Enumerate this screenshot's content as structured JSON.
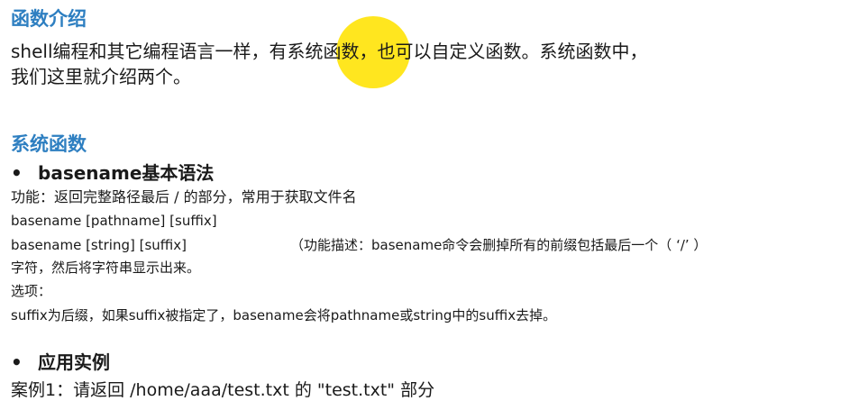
{
  "section1": {
    "title": "函数介绍",
    "line1": "shell编程和其它编程语言一样，有系统函数，也可以自定义函数。系统函数中，",
    "line2": "我们这里就介绍两个。"
  },
  "section2": {
    "title": "系统函数",
    "bullet1": "basename基本语法",
    "func_line": "功能：返回完整路径最后 / 的部分，常用于获取文件名",
    "syntax1": "basename [pathname] [suffix]",
    "syntax2": "basename [string] [suffix]",
    "desc1": "（功能描述：basename命令会删掉所有的前缀包括最后一个（ ‘/’ ）",
    "desc2": "字符，然后将字符串显示出来。",
    "options_label": "选项：",
    "options_text": "suffix为后缀，如果suffix被指定了，basename会将pathname或string中的suffix去掉。",
    "bullet2": "应用实例",
    "example1": "案例1：请返回 /home/aaa/test.txt 的 \"test.txt\" 部分"
  },
  "colors": {
    "heading": "#2e7fc1",
    "highlight": "#ffe200",
    "text": "#1a1a1a"
  }
}
